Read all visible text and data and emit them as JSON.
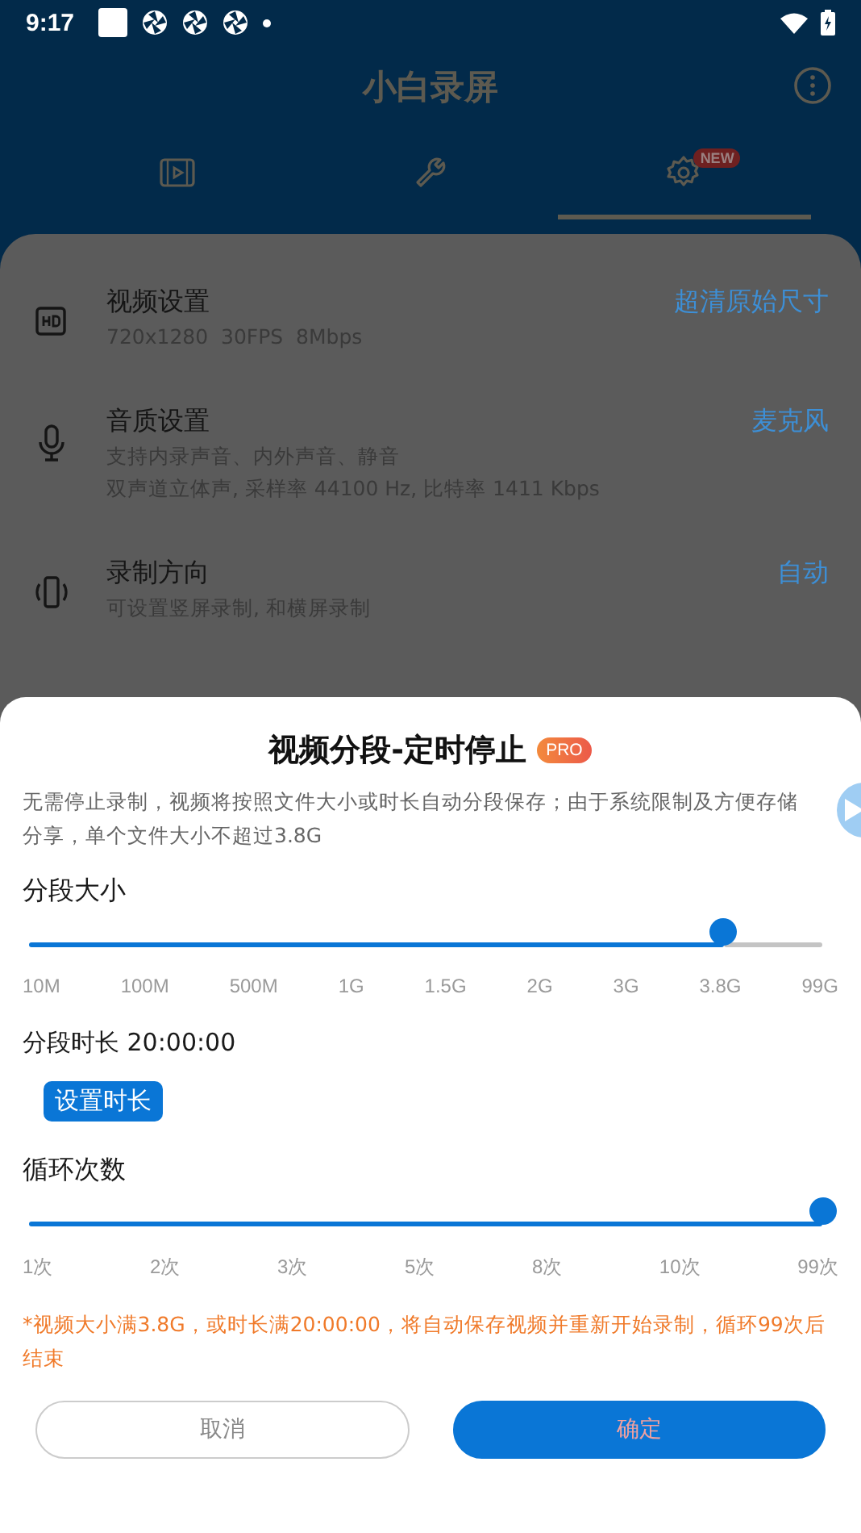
{
  "status_bar": {
    "time": "9:17"
  },
  "app_bar": {
    "title": "小白录屏"
  },
  "tabs": [
    {
      "kind": "video",
      "selected": false
    },
    {
      "kind": "tools",
      "selected": false
    },
    {
      "kind": "settings",
      "selected": true,
      "badge": "NEW"
    }
  ],
  "settings": [
    {
      "kind": "hd",
      "title": "视频设置",
      "subtitles": [
        "720x1280  30FPS  8Mbps"
      ],
      "value": "超清原始尺寸"
    },
    {
      "kind": "mic",
      "title": "音质设置",
      "subtitles": [
        "支持内录声音、内外声音、静音",
        "双声道立体声, 采样率 44100 Hz, 比特率 1411 Kbps"
      ],
      "value": "麦克风"
    },
    {
      "kind": "rotate",
      "title": "录制方向",
      "subtitles": [
        "可设置竖屏录制, 和横屏录制"
      ],
      "value": "自动"
    }
  ],
  "dialog": {
    "title": "视频分段-定时停止",
    "badge": "PRO",
    "description": "无需停止录制，视频将按照文件大小或时长自动分段保存；由于系统限制及方便存储分享，单个文件大小不超过3.8G",
    "size_slider": {
      "label": "分段大小",
      "level": 0.875,
      "ticks": [
        "10M",
        "100M",
        "500M",
        "1G",
        "1.5G",
        "2G",
        "3G",
        "3.8G",
        "99G"
      ]
    },
    "duration": {
      "label": "分段时长 20:00:00",
      "button": "设置时长"
    },
    "loop_slider": {
      "label": "循环次数",
      "level": 1,
      "ticks": [
        "1次",
        "2次",
        "3次",
        "5次",
        "8次",
        "10次",
        "99次"
      ]
    },
    "note": "*视频大小满3.8G，或时长满20:00:00，将自动保存视频并重新开始录制，循环99次后结束",
    "buttons": [
      {
        "kind": "secondary",
        "label": "取消"
      },
      {
        "kind": "primary",
        "label": "确定"
      }
    ]
  }
}
